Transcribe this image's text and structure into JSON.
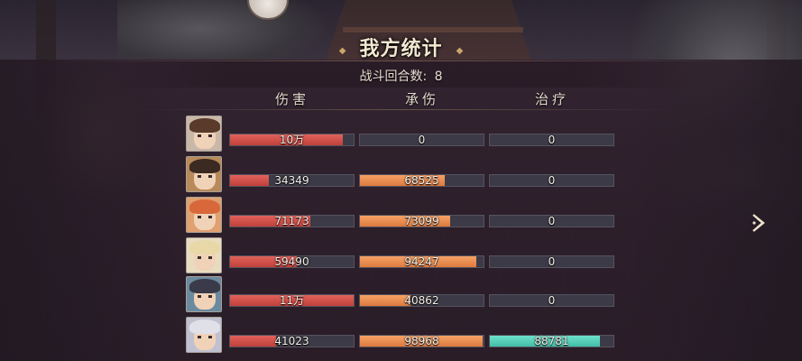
{
  "title": "我方统计",
  "rounds": {
    "label": "战斗回合数:",
    "value": "8"
  },
  "columns": {
    "damage": "伤害",
    "taken": "承伤",
    "heal": "治疗"
  },
  "colors": {
    "damage": "#d4504a",
    "taken": "#ec8c50",
    "heal": "#56d0b8",
    "bar_bg": "#3c3a46"
  },
  "max": {
    "damage": 110000,
    "taken": 100000,
    "heal": 100000
  },
  "rows": [
    {
      "hero": "hero-avatar-1",
      "damage": {
        "label": "10万",
        "value": 100000
      },
      "taken": {
        "label": "0",
        "value": 0
      },
      "heal": {
        "label": "0",
        "value": 0
      }
    },
    {
      "hero": "hero-avatar-2",
      "damage": {
        "label": "34349",
        "value": 34349
      },
      "taken": {
        "label": "68525",
        "value": 68525
      },
      "heal": {
        "label": "0",
        "value": 0
      }
    },
    {
      "hero": "hero-avatar-3",
      "damage": {
        "label": "71173",
        "value": 71173
      },
      "taken": {
        "label": "73099",
        "value": 73099
      },
      "heal": {
        "label": "0",
        "value": 0
      }
    },
    {
      "hero": "hero-avatar-4",
      "damage": {
        "label": "59490",
        "value": 59490
      },
      "taken": {
        "label": "94247",
        "value": 94247
      },
      "heal": {
        "label": "0",
        "value": 0
      }
    },
    {
      "hero": "hero-avatar-5",
      "damage": {
        "label": "11万",
        "value": 110000
      },
      "taken": {
        "label": "40862",
        "value": 40862
      },
      "heal": {
        "label": "0",
        "value": 0
      }
    },
    {
      "hero": "hero-avatar-6",
      "damage": {
        "label": "41023",
        "value": 41023
      },
      "taken": {
        "label": "98968",
        "value": 98968
      },
      "heal": {
        "label": "88781",
        "value": 88781
      }
    }
  ],
  "next_icon": "next-arrow-icon"
}
